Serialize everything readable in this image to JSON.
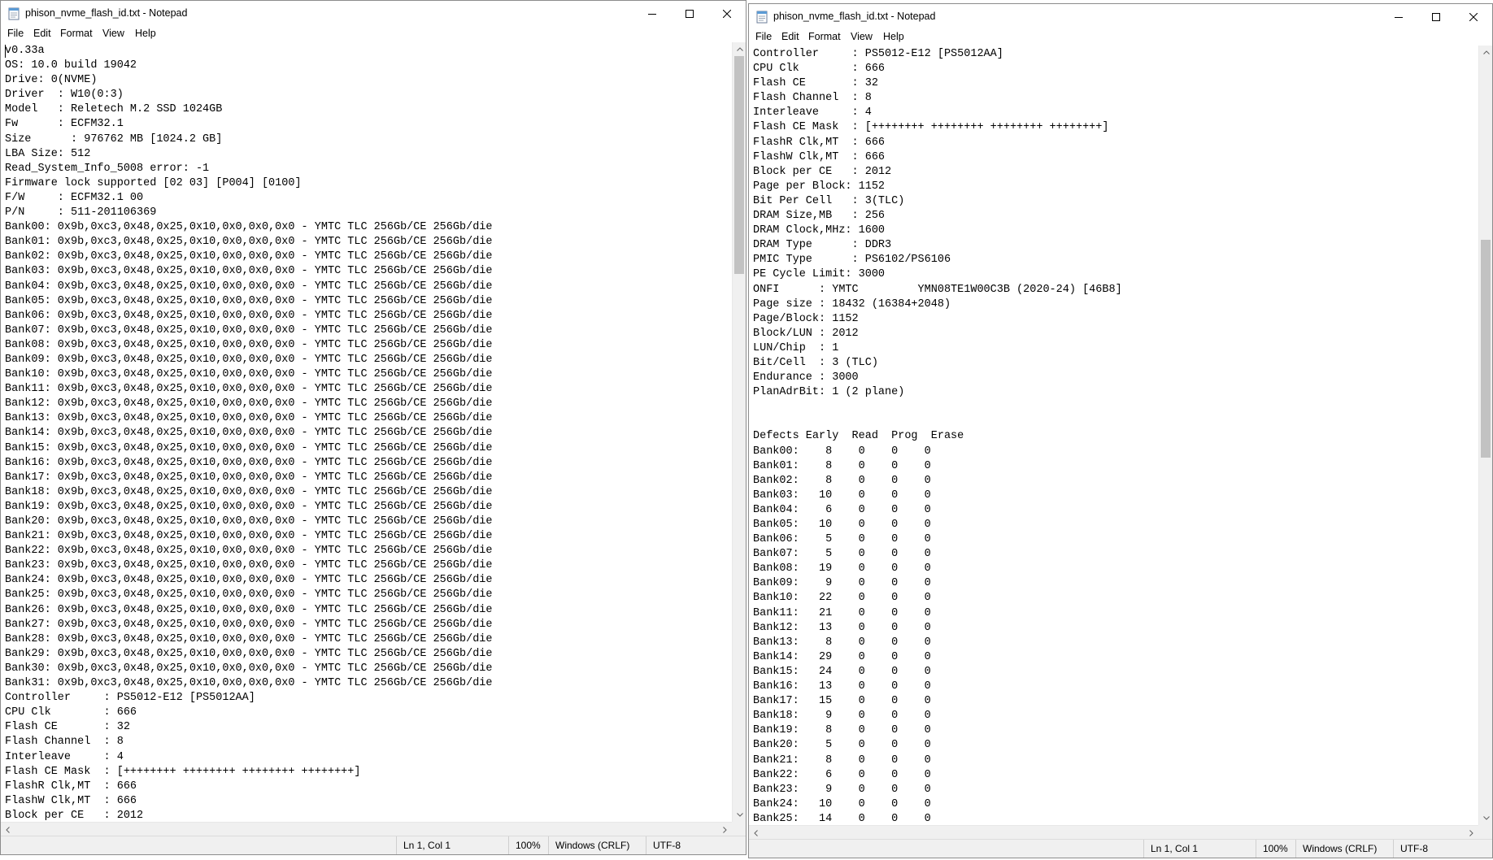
{
  "windows": [
    {
      "title": "phison_nvme_flash_id.txt - Notepad",
      "menu": [
        "File",
        "Edit",
        "Format",
        "View",
        "Help"
      ],
      "lines": [
        "v0.33a",
        "OS: 10.0 build 19042",
        "Drive: 0(NVME)",
        "Driver  : W10(0:3)",
        "Model   : Reletech M.2 SSD 1024GB",
        "Fw      : ECFM32.1",
        "Size      : 976762 MB [1024.2 GB]",
        "LBA Size: 512",
        "Read_System_Info_5008 error: -1",
        "Firmware lock supported [02 03] [P004] [0100]",
        "F/W     : ECFM32.1 00",
        "P/N     : 511-201106369",
        "Bank00: 0x9b,0xc3,0x48,0x25,0x10,0x0,0x0,0x0 - YMTC TLC 256Gb/CE 256Gb/die",
        "Bank01: 0x9b,0xc3,0x48,0x25,0x10,0x0,0x0,0x0 - YMTC TLC 256Gb/CE 256Gb/die",
        "Bank02: 0x9b,0xc3,0x48,0x25,0x10,0x0,0x0,0x0 - YMTC TLC 256Gb/CE 256Gb/die",
        "Bank03: 0x9b,0xc3,0x48,0x25,0x10,0x0,0x0,0x0 - YMTC TLC 256Gb/CE 256Gb/die",
        "Bank04: 0x9b,0xc3,0x48,0x25,0x10,0x0,0x0,0x0 - YMTC TLC 256Gb/CE 256Gb/die",
        "Bank05: 0x9b,0xc3,0x48,0x25,0x10,0x0,0x0,0x0 - YMTC TLC 256Gb/CE 256Gb/die",
        "Bank06: 0x9b,0xc3,0x48,0x25,0x10,0x0,0x0,0x0 - YMTC TLC 256Gb/CE 256Gb/die",
        "Bank07: 0x9b,0xc3,0x48,0x25,0x10,0x0,0x0,0x0 - YMTC TLC 256Gb/CE 256Gb/die",
        "Bank08: 0x9b,0xc3,0x48,0x25,0x10,0x0,0x0,0x0 - YMTC TLC 256Gb/CE 256Gb/die",
        "Bank09: 0x9b,0xc3,0x48,0x25,0x10,0x0,0x0,0x0 - YMTC TLC 256Gb/CE 256Gb/die",
        "Bank10: 0x9b,0xc3,0x48,0x25,0x10,0x0,0x0,0x0 - YMTC TLC 256Gb/CE 256Gb/die",
        "Bank11: 0x9b,0xc3,0x48,0x25,0x10,0x0,0x0,0x0 - YMTC TLC 256Gb/CE 256Gb/die",
        "Bank12: 0x9b,0xc3,0x48,0x25,0x10,0x0,0x0,0x0 - YMTC TLC 256Gb/CE 256Gb/die",
        "Bank13: 0x9b,0xc3,0x48,0x25,0x10,0x0,0x0,0x0 - YMTC TLC 256Gb/CE 256Gb/die",
        "Bank14: 0x9b,0xc3,0x48,0x25,0x10,0x0,0x0,0x0 - YMTC TLC 256Gb/CE 256Gb/die",
        "Bank15: 0x9b,0xc3,0x48,0x25,0x10,0x0,0x0,0x0 - YMTC TLC 256Gb/CE 256Gb/die",
        "Bank16: 0x9b,0xc3,0x48,0x25,0x10,0x0,0x0,0x0 - YMTC TLC 256Gb/CE 256Gb/die",
        "Bank17: 0x9b,0xc3,0x48,0x25,0x10,0x0,0x0,0x0 - YMTC TLC 256Gb/CE 256Gb/die",
        "Bank18: 0x9b,0xc3,0x48,0x25,0x10,0x0,0x0,0x0 - YMTC TLC 256Gb/CE 256Gb/die",
        "Bank19: 0x9b,0xc3,0x48,0x25,0x10,0x0,0x0,0x0 - YMTC TLC 256Gb/CE 256Gb/die",
        "Bank20: 0x9b,0xc3,0x48,0x25,0x10,0x0,0x0,0x0 - YMTC TLC 256Gb/CE 256Gb/die",
        "Bank21: 0x9b,0xc3,0x48,0x25,0x10,0x0,0x0,0x0 - YMTC TLC 256Gb/CE 256Gb/die",
        "Bank22: 0x9b,0xc3,0x48,0x25,0x10,0x0,0x0,0x0 - YMTC TLC 256Gb/CE 256Gb/die",
        "Bank23: 0x9b,0xc3,0x48,0x25,0x10,0x0,0x0,0x0 - YMTC TLC 256Gb/CE 256Gb/die",
        "Bank24: 0x9b,0xc3,0x48,0x25,0x10,0x0,0x0,0x0 - YMTC TLC 256Gb/CE 256Gb/die",
        "Bank25: 0x9b,0xc3,0x48,0x25,0x10,0x0,0x0,0x0 - YMTC TLC 256Gb/CE 256Gb/die",
        "Bank26: 0x9b,0xc3,0x48,0x25,0x10,0x0,0x0,0x0 - YMTC TLC 256Gb/CE 256Gb/die",
        "Bank27: 0x9b,0xc3,0x48,0x25,0x10,0x0,0x0,0x0 - YMTC TLC 256Gb/CE 256Gb/die",
        "Bank28: 0x9b,0xc3,0x48,0x25,0x10,0x0,0x0,0x0 - YMTC TLC 256Gb/CE 256Gb/die",
        "Bank29: 0x9b,0xc3,0x48,0x25,0x10,0x0,0x0,0x0 - YMTC TLC 256Gb/CE 256Gb/die",
        "Bank30: 0x9b,0xc3,0x48,0x25,0x10,0x0,0x0,0x0 - YMTC TLC 256Gb/CE 256Gb/die",
        "Bank31: 0x9b,0xc3,0x48,0x25,0x10,0x0,0x0,0x0 - YMTC TLC 256Gb/CE 256Gb/die",
        "Controller     : PS5012-E12 [PS5012AA]",
        "CPU Clk        : 666",
        "Flash CE       : 32",
        "Flash Channel  : 8",
        "Interleave     : 4",
        "Flash CE Mask  : [++++++++ ++++++++ ++++++++ ++++++++]",
        "FlashR Clk,MT  : 666",
        "FlashW Clk,MT  : 666",
        "Block per CE   : 2012"
      ],
      "status": {
        "position": "Ln 1, Col 1",
        "zoom": "100%",
        "line_ending": "Windows (CRLF)",
        "encoding": "UTF-8"
      },
      "scroll_thumb": {
        "start": 0.0,
        "size": 0.29
      }
    },
    {
      "title": "phison_nvme_flash_id.txt - Notepad",
      "menu": [
        "File",
        "Edit",
        "Format",
        "View",
        "Help"
      ],
      "lines": [
        "Controller     : PS5012-E12 [PS5012AA]",
        "CPU Clk        : 666",
        "Flash CE       : 32",
        "Flash Channel  : 8",
        "Interleave     : 4",
        "Flash CE Mask  : [++++++++ ++++++++ ++++++++ ++++++++]",
        "FlashR Clk,MT  : 666",
        "FlashW Clk,MT  : 666",
        "Block per CE   : 2012",
        "Page per Block: 1152",
        "Bit Per Cell   : 3(TLC)",
        "DRAM Size,MB   : 256",
        "DRAM Clock,MHz: 1600",
        "DRAM Type      : DDR3",
        "PMIC Type      : PS6102/PS6106",
        "PE Cycle Limit: 3000",
        "ONFI      : YMTC         YMN08TE1W00C3B (2020-24) [46B8]",
        "Page size : 18432 (16384+2048)",
        "Page/Block: 1152",
        "Block/LUN : 2012",
        "LUN/Chip  : 1",
        "Bit/Cell  : 3 (TLC)",
        "Endurance : 3000",
        "PlanAdrBit: 1 (2 plane)",
        "",
        "",
        "Defects Early  Read  Prog  Erase",
        "Bank00:    8    0    0    0",
        "Bank01:    8    0    0    0",
        "Bank02:    8    0    0    0",
        "Bank03:   10    0    0    0",
        "Bank04:    6    0    0    0",
        "Bank05:   10    0    0    0",
        "Bank06:    5    0    0    0",
        "Bank07:    5    0    0    0",
        "Bank08:   19    0    0    0",
        "Bank09:    9    0    0    0",
        "Bank10:   22    0    0    0",
        "Bank11:   21    0    0    0",
        "Bank12:   13    0    0    0",
        "Bank13:    8    0    0    0",
        "Bank14:   29    0    0    0",
        "Bank15:   24    0    0    0",
        "Bank16:   13    0    0    0",
        "Bank17:   15    0    0    0",
        "Bank18:    9    0    0    0",
        "Bank19:    8    0    0    0",
        "Bank20:    5    0    0    0",
        "Bank21:    8    0    0    0",
        "Bank22:    6    0    0    0",
        "Bank23:    9    0    0    0",
        "Bank24:   10    0    0    0",
        "Bank25:   14    0    0    0"
      ],
      "status": {
        "position": "Ln 1, Col 1",
        "zoom": "100%",
        "line_ending": "Windows (CRLF)",
        "encoding": "UTF-8"
      },
      "scroll_thumb": {
        "start": 0.24,
        "size": 0.29
      }
    }
  ],
  "icons": {
    "app": "notepad-icon",
    "minimize": "minimize-icon",
    "maximize": "maximize-icon",
    "close": "close-icon"
  },
  "colors": {
    "window_bg": "#ffffff",
    "chrome_bg": "#f0f0f0",
    "scroll_thumb": "#c2c2c2",
    "text": "#000000"
  }
}
